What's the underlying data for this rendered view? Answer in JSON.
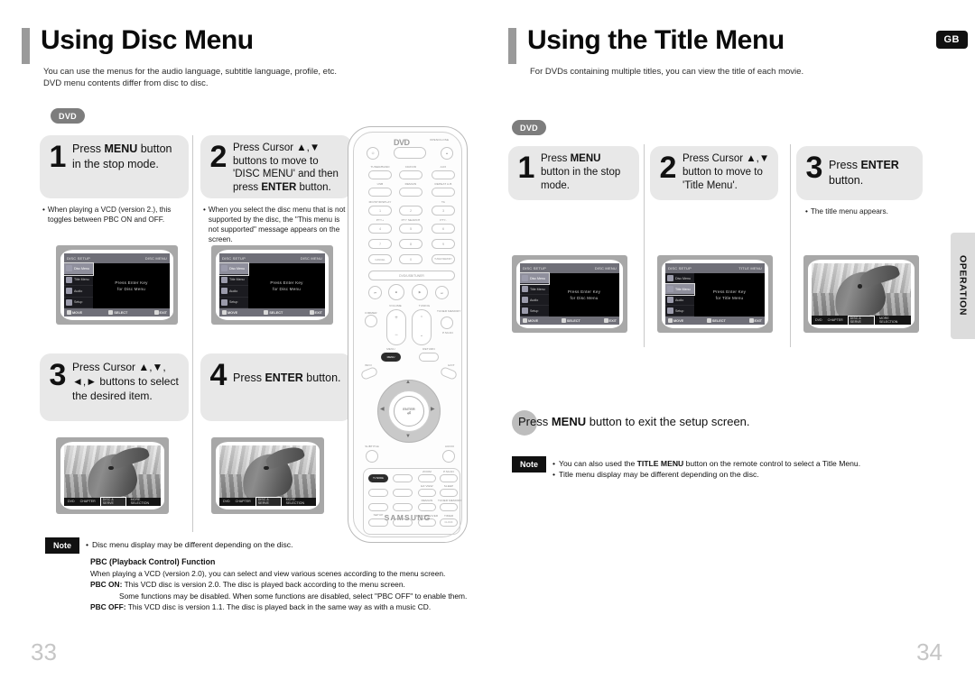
{
  "left": {
    "heading": "Using Disc Menu",
    "sub_line1": "You can use the menus for the audio language, subtitle language, profile, etc.",
    "sub_line2": "DVD menu contents differ from disc to disc.",
    "badge": "DVD",
    "steps": [
      {
        "num": "1",
        "text_parts": [
          "Press ",
          "MENU",
          " button in the stop mode."
        ],
        "bullet": "When playing a VCD (version 2.), this toggles between PBC ON and OFF."
      },
      {
        "num": "2",
        "text_parts": [
          "Press Cursor ▲,▼ buttons to move to 'DISC MENU' and then press ",
          "ENTER",
          " button."
        ],
        "bullet": "When you select the disc menu that is not supported by the disc, the \"This menu is not supported\" message appears on the screen."
      },
      {
        "num": "3",
        "text_parts": [
          "Press Cursor ▲,▼, ◄,► buttons to select the desired item."
        ],
        "bullet": ""
      },
      {
        "num": "4",
        "text_parts": [
          "Press ",
          "ENTER",
          " button."
        ],
        "bullet": ""
      }
    ],
    "note": {
      "tag": "Note",
      "lines": [
        "Disc menu display may be different depending on the disc."
      ]
    },
    "pbc": {
      "title": "PBC (Playback Control) Function",
      "intro": "When playing a VCD (version 2.0), you can select and view various scenes according to the menu screen.",
      "on_label": "PBC ON:",
      "on_text": "This VCD disc is version 2.0. The disc is played back according to the menu screen.",
      "on_text2": "Some functions may be disabled. When some functions are disabled, select \"PBC OFF\" to enable them.",
      "off_label": "PBC OFF:",
      "off_text": "This VCD disc is version 1.1. The disc is played back in the same way as with a music CD."
    },
    "page_number": "33"
  },
  "right": {
    "heading": "Using the Title Menu",
    "sub_line1": "For DVDs containing multiple titles, you can view the title of each movie.",
    "gb_badge": "GB",
    "badge": "DVD",
    "steps": [
      {
        "num": "1",
        "text_parts": [
          "Press ",
          "MENU",
          " button in the stop mode."
        ],
        "bullet": ""
      },
      {
        "num": "2",
        "text_parts": [
          "Press Cursor ▲,▼ button to move to 'Title Menu'."
        ],
        "bullet": ""
      },
      {
        "num": "3",
        "text_parts": [
          "Press ",
          "ENTER",
          " button."
        ],
        "bullet": "The title menu appears."
      }
    ],
    "exit_line": [
      "Press ",
      "MENU",
      " button to exit the setup screen."
    ],
    "note": {
      "tag": "Note",
      "line1_a": "You can also used the ",
      "line1_b": "TITLE MENU",
      "line1_c": " button on the remote control to select a Title Menu.",
      "line2": "Title menu display may be different depending on the disc."
    },
    "page_number": "34",
    "side_tab": "OPERATION"
  },
  "osd": {
    "disc_menu_header_left": "DISC SETUP",
    "disc_menu_header_right": "DISC MENU",
    "title_menu_header_right": "TITLE MENU",
    "items": [
      "Disc Menu",
      "Title Menu",
      "Audio",
      "Setup"
    ],
    "body_disc_line1": "Press Enter Key",
    "body_disc_line2": "for Disc Menu",
    "body_title_line1": "Press Enter Key",
    "body_title_line2": "for Title Menu",
    "footer_move": "MOVE",
    "footer_select": "SELECT",
    "footer_exit": "EXIT"
  },
  "scene_bar": {
    "items": [
      "DVD",
      "CHAPTER",
      "DISC & SERVE",
      "MORE SELECTION"
    ],
    "highlight_index": 2
  },
  "remote": {
    "logo": "DVD",
    "brand": "SAMSUNG",
    "labels_top": [
      "OPEN/CLOSE"
    ],
    "top_row": [
      "TUNER/BAND",
      "CD/DVD",
      "AUX"
    ],
    "row2": [
      "USB",
      "REMAIN",
      "REPEAT A-B"
    ],
    "numbers": [
      "1",
      "2",
      "3",
      "4",
      "5",
      "6",
      "7",
      "8",
      "9",
      "CANCEL",
      "0",
      "TUNER MEMORY"
    ],
    "num_labels": [
      "MO/ST/DISPLAY",
      "",
      "TA",
      "PTY+",
      "PTY SEARCH",
      "PTY-"
    ],
    "mode_bar": "DVD/USB/TUNER",
    "volume_label": "VOLUME",
    "tuning_label": "TUNING",
    "menu_button": "MENU",
    "return_button": "RETURN",
    "enter_button": "ENTER",
    "info_button": "INFO",
    "exit_button": "EXIT",
    "subtitle_button": "SUBTITLE",
    "audio_button": "AUDIO",
    "dimmer_button": "DIMMER",
    "memory_label": "TUNER MEMORY / P.SCAN",
    "bottom_panel": [
      [
        "TV MODE",
        "TEST TONE",
        "ZOOM",
        "P.SCAN"
      ],
      [
        "MO/ST",
        "PHOTO BG",
        "EZ VIEW",
        "SLEEP"
      ],
      [
        "LOGO",
        "STEP",
        "REMAIN",
        "TUNER MEMORY"
      ],
      [
        "SETUP",
        "GROUP",
        "DVD RECEIVER",
        "TIMER/CLOCK"
      ]
    ],
    "highlighted_buttons": [
      "MENU",
      "TV MODE"
    ]
  },
  "colors": {
    "accent_bar": "#9a9a9a",
    "step_bg": "#e8e8e8",
    "badge_bg": "#7d7d7d",
    "note_bg": "#111111",
    "page_number": "#c6c6c6",
    "tab_bg": "#dcdcdc"
  }
}
